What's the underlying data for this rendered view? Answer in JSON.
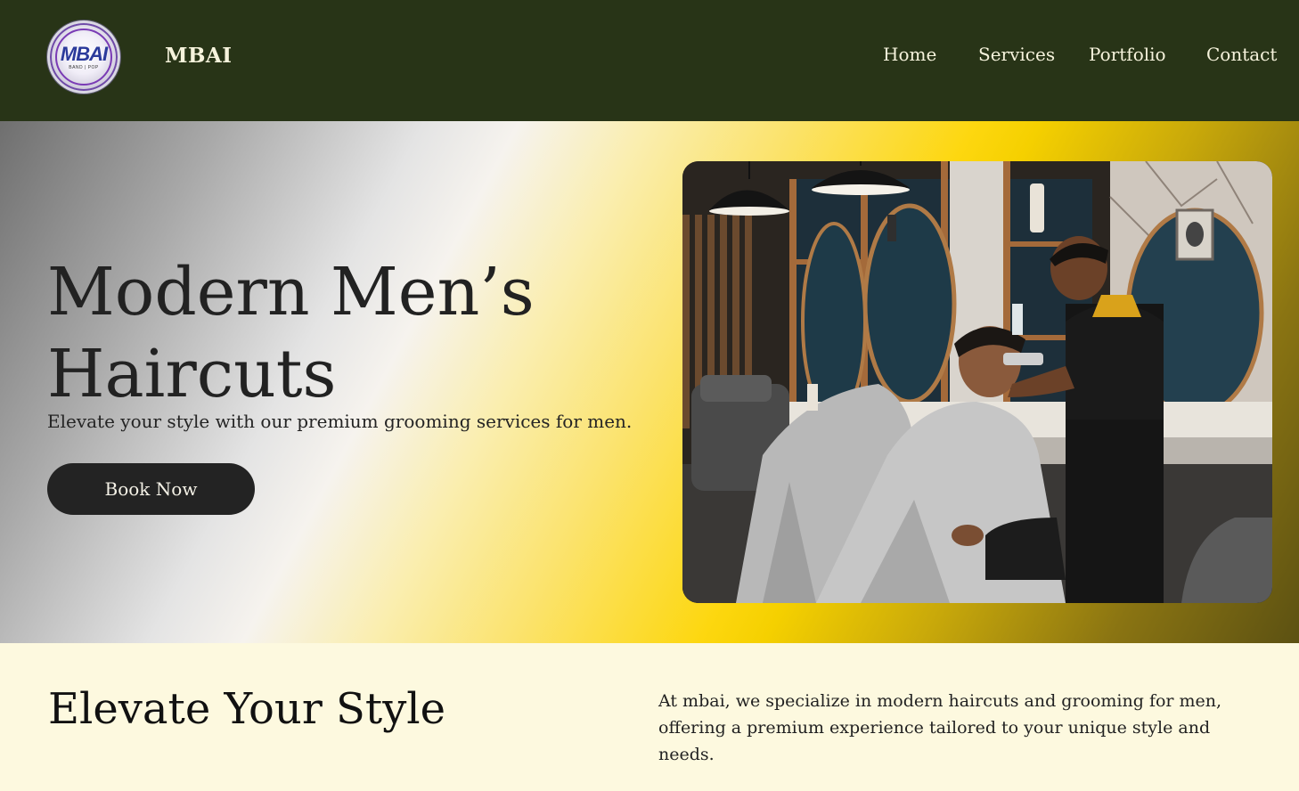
{
  "header": {
    "logo_text": "MBAI",
    "logo_subtext": "BAND | POP",
    "brand": "MBAI",
    "nav": [
      "Home",
      "Services",
      "Portfolio",
      "Contact"
    ]
  },
  "hero": {
    "title": "Modern Men’s Haircuts",
    "subtitle": "Elevate your style with our premium grooming services for men.",
    "cta_label": "Book Now"
  },
  "about": {
    "title": "Elevate Your Style",
    "text": "At mbai, we specialize in modern haircuts and grooming for men, offering a premium experience tailored to your unique style and needs."
  },
  "colors": {
    "header_bg": "#283417",
    "nav_text": "#f6f3dc",
    "button_bg": "#232323",
    "section_bg": "#fdf9df",
    "accent_yellow": "#fdd70f"
  }
}
